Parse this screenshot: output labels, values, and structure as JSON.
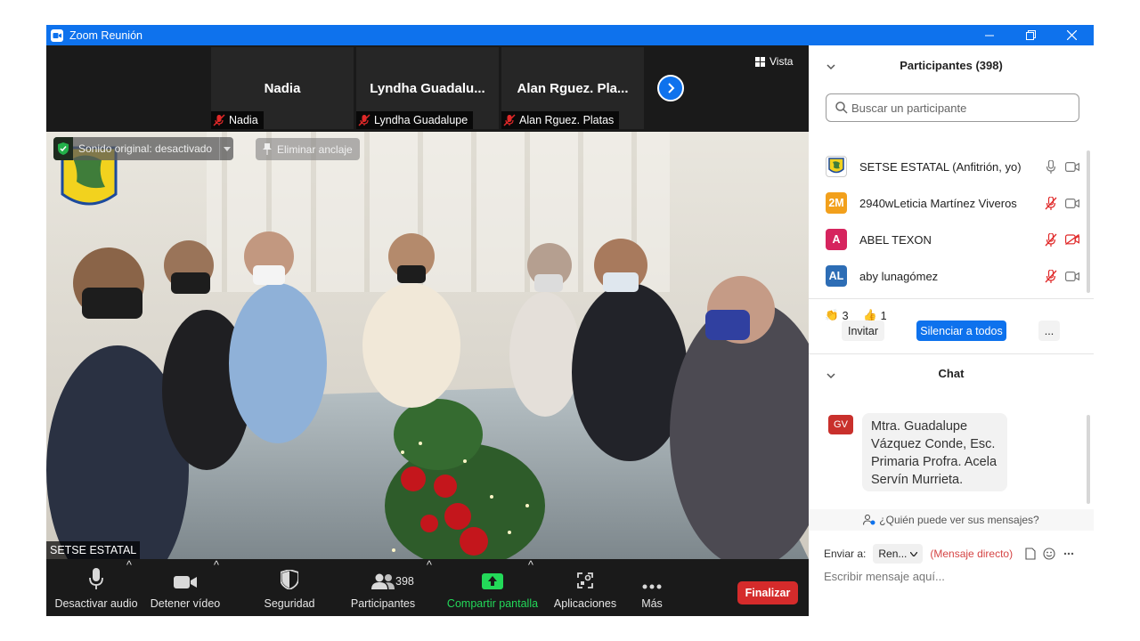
{
  "window": {
    "title": "Zoom Reunión"
  },
  "top_tiles": [
    {
      "name": "Nadia",
      "label": "Nadia"
    },
    {
      "name": "Lyndha  Guadalu...",
      "label": "Lyndha Guadalupe"
    },
    {
      "name": "Alan  Rguez. Pla...",
      "label": "Alan  Rguez. Platas"
    }
  ],
  "view_button": "Vista",
  "original_sound": "Sonido original: desactivado",
  "unpin": "Eliminar anclaje",
  "active_speaker": "SETSE ESTATAL",
  "toolbar": {
    "mute": "Desactivar audio",
    "video": "Detener vídeo",
    "security": "Seguridad",
    "participants": "Participantes",
    "participants_count": "398",
    "share": "Compartir pantalla",
    "apps": "Aplicaciones",
    "more": "Más",
    "end": "Finalizar"
  },
  "participants_panel": {
    "title": "Participantes (398)",
    "search_placeholder": "Buscar un participante",
    "list": [
      {
        "initials": "",
        "name": "SETSE ESTATAL (Anfitrión, yo)",
        "color": "#2f6e2a"
      },
      {
        "initials": "2M",
        "name": "2940wLeticia Martínez Viveros",
        "color": "#f2a01c"
      },
      {
        "initials": "A",
        "name": "ABEL TEXON",
        "color": "#d6245e"
      },
      {
        "initials": "AL",
        "name": "aby lunagómez",
        "color": "#2d6db5"
      }
    ],
    "reactions": [
      {
        "emoji": "👏",
        "count": "3"
      },
      {
        "emoji": "👍",
        "count": "1"
      }
    ],
    "invite": "Invitar",
    "mute_all": "Silenciar a todos",
    "more": "..."
  },
  "chat": {
    "title": "Chat",
    "sender_initials": "GV",
    "message": "Mtra. Guadalupe Vázquez Conde, Esc. Primaria Profra. Acela Servín Murrieta.",
    "who_can_see": "¿Quién puede ver sus mensajes?",
    "send_to_label": "Enviar a:",
    "recipient": "Ren...",
    "direct": "(Mensaje directo)",
    "input_placeholder": "Escribir mensaje aquí..."
  },
  "colors": {
    "zoom_blue": "#0e72ed",
    "end_red": "#d52b2b",
    "share_green": "#23d959"
  }
}
